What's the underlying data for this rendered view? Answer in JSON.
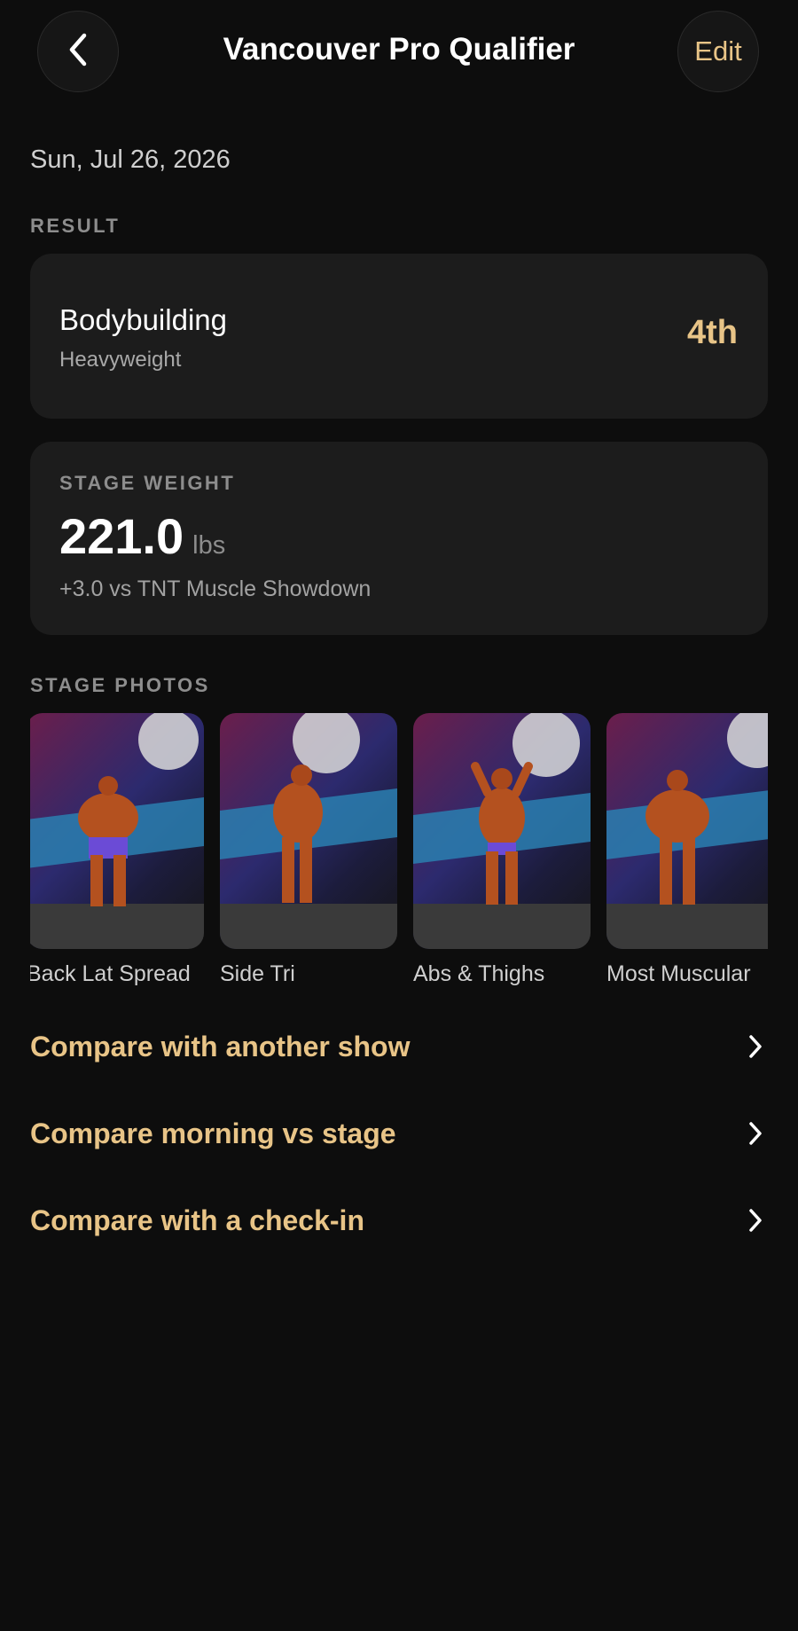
{
  "header": {
    "title": "Vancouver Pro Qualifier",
    "edit_label": "Edit"
  },
  "date": "Sun, Jul 26, 2026",
  "result": {
    "section_label": "RESULT",
    "division": "Bodybuilding",
    "class": "Heavyweight",
    "placing": "4th"
  },
  "stage_weight": {
    "label": "STAGE WEIGHT",
    "value": "221.0",
    "unit": "lbs",
    "delta": "+3.0 vs TNT Muscle Showdown"
  },
  "stage_photos": {
    "section_label": "STAGE PHOTOS",
    "items": [
      {
        "label": "Back Lat Spread"
      },
      {
        "label": "Side Tri"
      },
      {
        "label": "Abs & Thighs"
      },
      {
        "label": "Most Muscular"
      }
    ]
  },
  "compare": [
    {
      "label": "Compare with another show"
    },
    {
      "label": "Compare morning vs stage"
    },
    {
      "label": "Compare with a check-in"
    }
  ],
  "colors": {
    "accent": "#e8c487",
    "background": "#0d0d0d",
    "card": "#1c1c1c"
  },
  "icons": {
    "back": "chevron-left-icon",
    "row": "chevron-right-icon"
  }
}
